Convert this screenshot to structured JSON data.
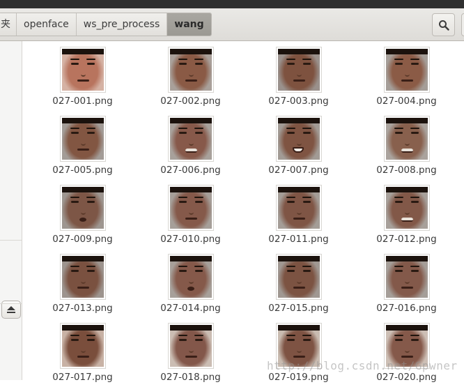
{
  "breadcrumbs": [
    {
      "label": "夹"
    },
    {
      "label": "openface"
    },
    {
      "label": "ws_pre_process"
    },
    {
      "label": "wang"
    }
  ],
  "toolbar": {
    "search_icon": "search-icon"
  },
  "files": [
    {
      "name": "027-001.png",
      "skin": "#b8745e",
      "bg": "#d5b2a4",
      "mouth": "closed"
    },
    {
      "name": "027-002.png",
      "skin": "#8a5a45",
      "bg": "#a9a09a",
      "mouth": "closed"
    },
    {
      "name": "027-003.png",
      "skin": "#7e523f",
      "bg": "#9a918c",
      "mouth": "closed"
    },
    {
      "name": "027-004.png",
      "skin": "#8b5b46",
      "bg": "#a59e98",
      "mouth": "closed"
    },
    {
      "name": "027-005.png",
      "skin": "#825642",
      "bg": "#a39c97",
      "mouth": "closed"
    },
    {
      "name": "027-006.png",
      "skin": "#87594a",
      "bg": "#a8a19b",
      "mouth": "smile"
    },
    {
      "name": "027-007.png",
      "skin": "#7f5442",
      "bg": "#a29b95",
      "mouth": "open"
    },
    {
      "name": "027-008.png",
      "skin": "#88604d",
      "bg": "#aaa39d",
      "mouth": "smile"
    },
    {
      "name": "027-009.png",
      "skin": "#7d5646",
      "bg": "#9e9690",
      "mouth": "o"
    },
    {
      "name": "027-010.png",
      "skin": "#85594a",
      "bg": "#a69f99",
      "mouth": "closed"
    },
    {
      "name": "027-011.png",
      "skin": "#7f5545",
      "bg": "#a49d97",
      "mouth": "closed"
    },
    {
      "name": "027-012.png",
      "skin": "#825848",
      "bg": "#a7a09a",
      "mouth": "smile"
    },
    {
      "name": "027-013.png",
      "skin": "#7a5140",
      "bg": "#9d948e",
      "mouth": "closed"
    },
    {
      "name": "027-014.png",
      "skin": "#85594a",
      "bg": "#a7a09a",
      "mouth": "o"
    },
    {
      "name": "027-015.png",
      "skin": "#7c5342",
      "bg": "#a09892",
      "mouth": "closed"
    },
    {
      "name": "027-016.png",
      "skin": "#83594a",
      "bg": "#a59e98",
      "mouth": "closed"
    },
    {
      "name": "027-017.png",
      "skin": "#7a4e3c",
      "bg": "#c8b2a5",
      "mouth": "closed"
    },
    {
      "name": "027-018.png",
      "skin": "#83574a",
      "bg": "#cbbdb3",
      "mouth": "closed"
    },
    {
      "name": "027-019.png",
      "skin": "#7e5343",
      "bg": "#c9bcb1",
      "mouth": "closed"
    },
    {
      "name": "027-020.png",
      "skin": "#85594a",
      "bg": "#cdbfb5",
      "mouth": "closed"
    }
  ],
  "watermark": "http://blog.csdn.net/Gpwner"
}
